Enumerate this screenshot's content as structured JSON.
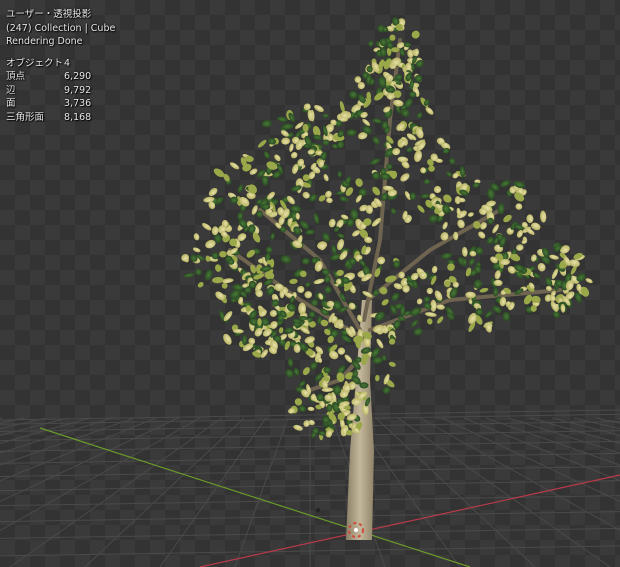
{
  "viewport": {
    "view_name": "ユーザー・透視投影",
    "collection_line": "(247) Collection | Cube",
    "status": "Rendering Done",
    "stats": [
      {
        "label": "オブジェクト",
        "value": "4"
      },
      {
        "label": "頂点",
        "value": "6,290"
      },
      {
        "label": "辺",
        "value": "9,792"
      },
      {
        "label": "面",
        "value": "3,736"
      },
      {
        "label": "三角形面",
        "value": "8,168"
      }
    ]
  },
  "colors": {
    "background": "#3a3a3a",
    "grid_line": "#4a4a4a",
    "x_axis": "#b83a4a",
    "y_axis": "#6a9a2a",
    "foliage_light": "#d8d49a",
    "foliage_mid": "#9aa84a",
    "foliage_dark": "#2f5a2a",
    "trunk": "#b8a88a"
  }
}
